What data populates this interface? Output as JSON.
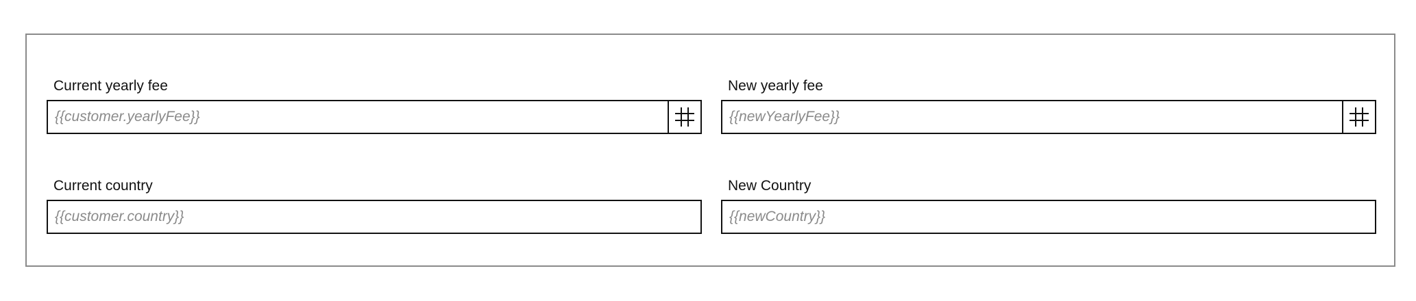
{
  "form": {
    "fields": [
      {
        "label": "Current yearly fee",
        "placeholder": "{{customer.yearlyFee}}",
        "value": "",
        "icon": "hash-icon"
      },
      {
        "label": "New yearly fee",
        "placeholder": "{{newYearlyFee}}",
        "value": "",
        "icon": "hash-icon"
      },
      {
        "label": "Current country",
        "placeholder": "{{customer.country}}",
        "value": ""
      },
      {
        "label": "New Country",
        "placeholder": "{{newCountry}}",
        "value": ""
      }
    ]
  },
  "colors": {
    "panel_border": "#8a8a8a",
    "field_border": "#111111",
    "placeholder_text": "#8a8a8a",
    "label_text": "#111111"
  }
}
